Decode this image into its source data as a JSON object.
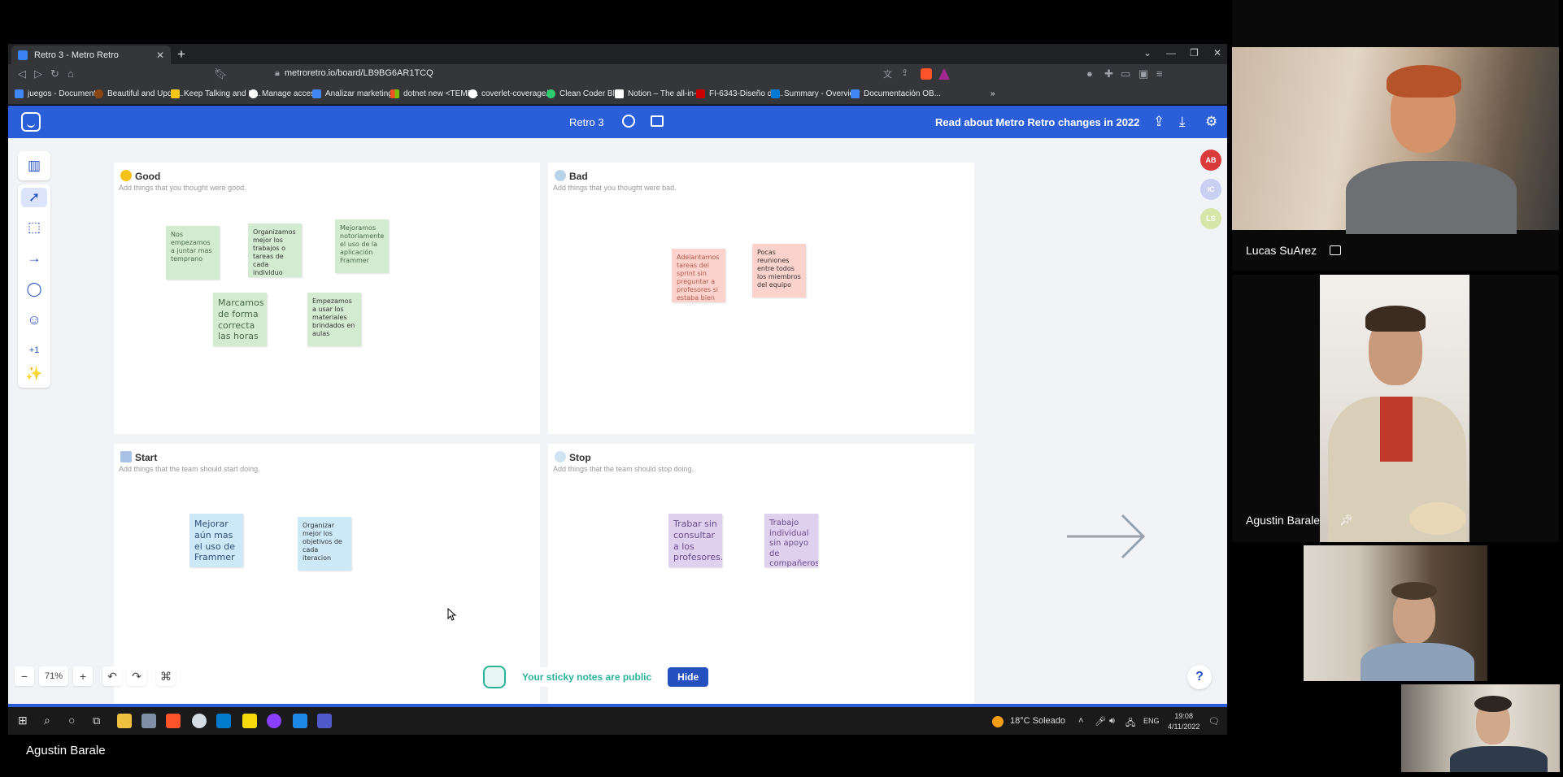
{
  "browser": {
    "tab_title": "Retro 3 - Metro Retro",
    "url": "metroretro.io/board/LB9BG6AR1TCQ",
    "bookmarks": [
      {
        "label": "juegos - Document...",
        "color": "#4285f4"
      },
      {
        "label": "Beautiful and Upda...",
        "color": "#8b4513"
      },
      {
        "label": "Keep Talking and N...",
        "color": "#f5c518"
      },
      {
        "label": "Manage access",
        "color": "#ffffff"
      },
      {
        "label": "Analizar marketing...",
        "color": "#4285f4"
      },
      {
        "label": "dotnet new <TEMP...",
        "color": "#f25022"
      },
      {
        "label": "coverlet-coverage/...",
        "color": "#ffffff"
      },
      {
        "label": "Clean Coder Blog",
        "color": "#2ecc71"
      },
      {
        "label": "Notion – The all-in-...",
        "color": "#ffffff"
      },
      {
        "label": "FI-6343-Diseño de...",
        "color": "#cc0000"
      },
      {
        "label": "Summary - Overview",
        "color": "#0078d4"
      },
      {
        "label": "Documentación OB...",
        "color": "#4285f4"
      }
    ]
  },
  "app": {
    "board_name": "Retro 3",
    "announcement": "Read about Metro Retro changes in 2022",
    "sections": {
      "good": {
        "title": "Good",
        "subtitle": "Add things that you thought were good.",
        "notes": [
          "Nos empezamos a juntar mas temprano",
          "Organizamos mejor los trabajos o tareas de cada individuo",
          "Mejoramos notoriamente el uso de la aplicación Frammer",
          "Marcamos de forma correcta las horas",
          "Empezamos a usar los materiales brindados en aulas"
        ]
      },
      "bad": {
        "title": "Bad",
        "subtitle": "Add things that you thought were bad.",
        "notes": [
          "Adelantamos tareas del sprint sin preguntar a profesores si estaba bien",
          "Pocas reuniones entre todos los miembros del equipo"
        ]
      },
      "start": {
        "title": "Start",
        "subtitle": "Add things that the team should start doing.",
        "notes": [
          "Mejorar aún mas el uso de Frammer",
          "Organizar mejor los objetivos de cada iteracion"
        ]
      },
      "stop": {
        "title": "Stop",
        "subtitle": "Add things that the team should stop doing.",
        "notes": [
          "Trabar sin consultar a los profesores.",
          "Trabajo individual sin apoyo de compañeros"
        ]
      }
    },
    "avatars": [
      {
        "initials": "AB",
        "color": "#d93b3b"
      },
      {
        "initials": "IC",
        "color": "#c9cff3"
      },
      {
        "initials": "LS",
        "color": "#d6e6a8"
      }
    ],
    "zoom": "71%",
    "public_notice": "Your sticky notes are public",
    "hide_label": "Hide",
    "help_label": "?"
  },
  "taskbar": {
    "weather": "18°C  Soleado",
    "lang": "ENG",
    "time": "19:08",
    "date": "4/11/2022"
  },
  "presenter_name": "Agustin Barale",
  "participants": [
    {
      "name": "Lucas SuArez"
    },
    {
      "name": "Agustin Barale"
    }
  ]
}
